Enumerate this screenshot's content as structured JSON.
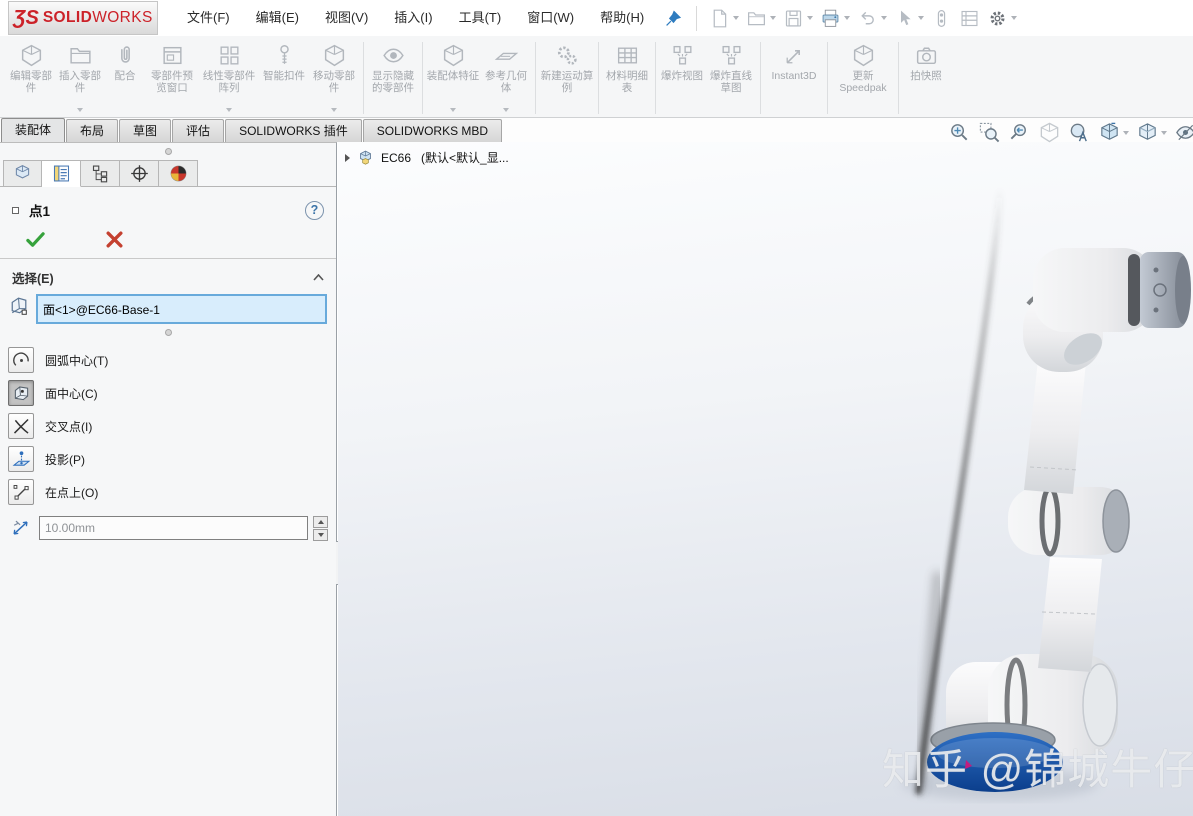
{
  "brand": {
    "prefix_glyph": "ƷS",
    "bold": "SOLID",
    "light": "WORKS"
  },
  "menubar": {
    "items": [
      "文件(F)",
      "编辑(E)",
      "视图(V)",
      "插入(I)",
      "工具(T)",
      "窗口(W)",
      "帮助(H)"
    ]
  },
  "quick_access": {
    "icons": [
      "new-document",
      "open",
      "save",
      "print",
      "undo",
      "select",
      "toggle-capsule",
      "task-list",
      "options-gear"
    ]
  },
  "ribbon": {
    "buttons": [
      {
        "label": "编辑零部件",
        "icon": "edit-component",
        "dropdown": false
      },
      {
        "label": "插入零部件",
        "icon": "insert-component",
        "dropdown": true
      },
      {
        "label": "配合",
        "icon": "mate",
        "dropdown": false
      },
      {
        "label": "零部件预览窗口",
        "icon": "component-preview-window",
        "dropdown": false
      },
      {
        "label": "线性零部件阵列",
        "icon": "linear-component-pattern",
        "dropdown": true
      },
      {
        "label": "智能扣件",
        "icon": "smart-fasteners",
        "dropdown": false
      },
      {
        "label": "移动零部件",
        "icon": "move-component",
        "dropdown": true
      },
      {
        "label": "显示隐藏的零部件",
        "icon": "show-hidden-components",
        "dropdown": false
      },
      {
        "label": "装配体特征",
        "icon": "assembly-features",
        "dropdown": true
      },
      {
        "label": "参考几何体",
        "icon": "reference-geometry",
        "dropdown": true
      },
      {
        "label": "新建运动算例",
        "icon": "new-motion-study",
        "dropdown": false
      },
      {
        "label": "材料明细表",
        "icon": "bill-of-materials",
        "dropdown": false
      },
      {
        "label": "爆炸视图",
        "icon": "exploded-view",
        "dropdown": false
      },
      {
        "label": "爆炸直线草图",
        "icon": "explode-line-sketch",
        "dropdown": false
      },
      {
        "label": "Instant3D",
        "icon": "instant3d",
        "dropdown": false
      },
      {
        "label": "更新 Speedpak",
        "icon": "update-speedpak",
        "dropdown": false
      },
      {
        "label": "拍快照",
        "icon": "take-snapshot",
        "dropdown": false
      }
    ]
  },
  "command_tabs": {
    "tabs": [
      "装配体",
      "布局",
      "草图",
      "评估",
      "SOLIDWORKS 插件",
      "SOLIDWORKS MBD"
    ],
    "active_index": 0
  },
  "headsup": {
    "icons": [
      "zoom-to-fit",
      "zoom-to-area",
      "previous-view",
      "section-view",
      "edit-appearance",
      "view-orientation",
      "display-style",
      "hide-show-items"
    ]
  },
  "property_panel": {
    "tabs": [
      "featuremanager",
      "propertymanager",
      "configurationmanager",
      "dimxpertmanager",
      "displaymanager"
    ],
    "active_tab": "propertymanager",
    "title": "点1",
    "help_glyph": "?",
    "selection": {
      "header": "选择(E)",
      "value": "面<1>@EC66-Base-1"
    },
    "options": [
      {
        "label": "圆弧中心(T)",
        "icon": "arc-center",
        "selected": false
      },
      {
        "label": "面中心(C)",
        "icon": "face-center",
        "selected": true
      },
      {
        "label": "交叉点(I)",
        "icon": "intersection",
        "selected": false
      },
      {
        "label": "投影(P)",
        "icon": "projection",
        "selected": false
      },
      {
        "label": "在点上(O)",
        "icon": "on-point",
        "selected": false
      }
    ],
    "distance": {
      "value": "10.00mm",
      "enabled": false
    }
  },
  "viewport": {
    "feature_tree": {
      "name": "EC66",
      "config": "(默认<默认_显..."
    },
    "watermark": "知乎 @锦城牛仔"
  },
  "colors": {
    "logo_red": "#cc2229",
    "accent_blue": "#2f7cbf",
    "selection_fill": "#d8edfc",
    "selection_border": "#68aadb",
    "base_blue": "#114f9f",
    "check_green": "#36a23c",
    "cross_red": "#c44030",
    "ribbon_bg": "#f5f6f7",
    "viewport_top": "#fcfdfe",
    "viewport_bottom": "#d8dde6"
  }
}
